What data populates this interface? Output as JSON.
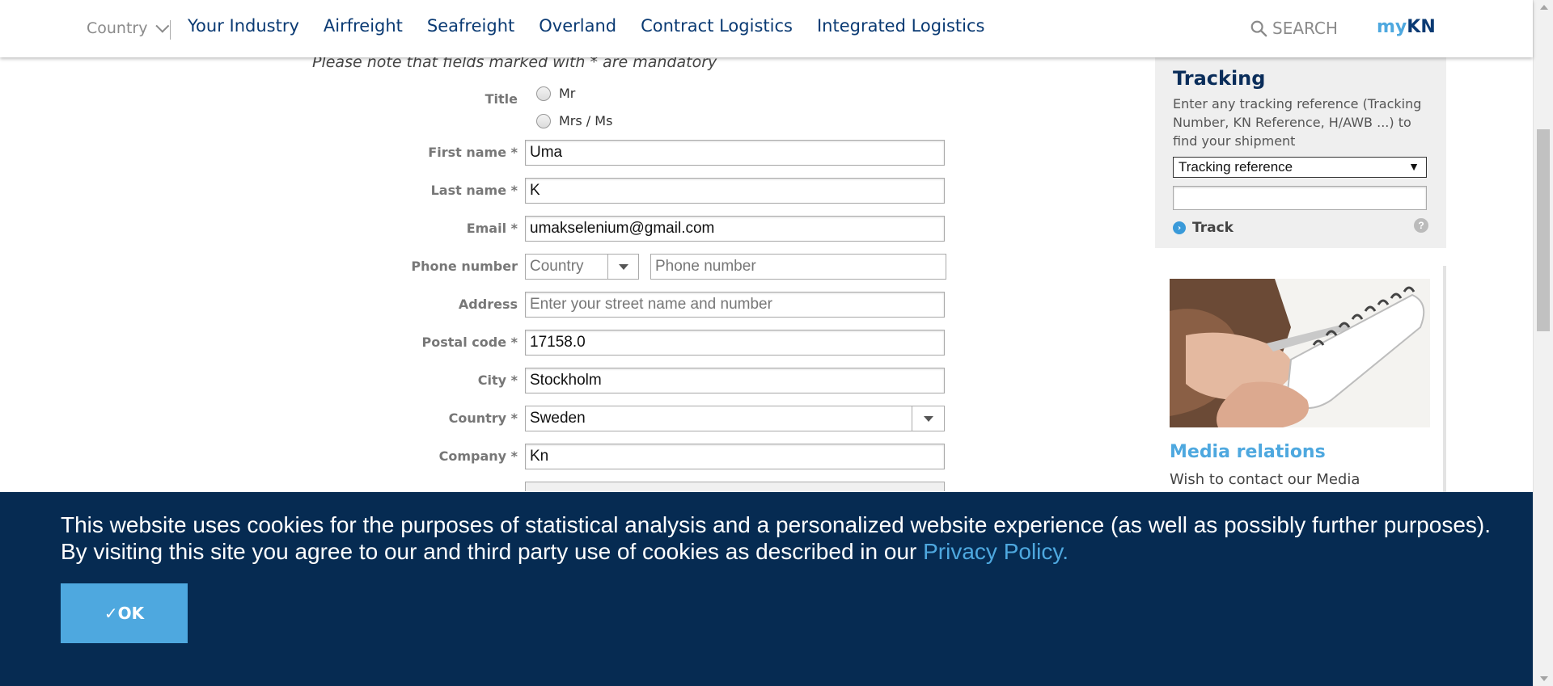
{
  "nav": {
    "country_label": "Country",
    "links": [
      "Your Industry",
      "Airfreight",
      "Seafreight",
      "Overland",
      "Contract Logistics",
      "Integrated Logistics"
    ],
    "search_label": "SEARCH",
    "mykn_my": "my",
    "mykn_kn": "KN"
  },
  "form": {
    "mandatory_note": "Please note that fields marked with * are mandatory",
    "title_label": "Title",
    "title_options": [
      "Mr",
      "Mrs / Ms"
    ],
    "first_name_label": "First name *",
    "first_name_value": "Uma",
    "last_name_label": "Last name *",
    "last_name_value": "K",
    "email_label": "Email *",
    "email_value": "umakselenium@gmail.com",
    "phone_label": "Phone number",
    "phone_country_placeholder": "Country",
    "phone_number_placeholder": "Phone number",
    "address_label": "Address",
    "address_placeholder": "Enter your street name and number",
    "postal_label": "Postal code *",
    "postal_value": "17158.0",
    "city_label": "City *",
    "city_value": "Stockholm",
    "country_label": "Country *",
    "country_value": "Sweden",
    "company_label": "Company *",
    "company_value": "Kn"
  },
  "tracking": {
    "title": "Tracking",
    "description": "Enter any tracking reference (Tracking Number, KN Reference, H/AWB ...) to find your shipment",
    "select_value": "Tracking reference",
    "button_label": "Track",
    "help": "?"
  },
  "media": {
    "title": "Media relations",
    "text": "Wish to contact our Media"
  },
  "cookie": {
    "text": "This website uses cookies for the purposes of statistical analysis and a personalized website experience (as well as possibly further purposes). By visiting this site you agree to our and third party use of cookies as described in our ",
    "link": "Privacy Policy.",
    "ok_label": "✓OK"
  },
  "colors": {
    "navy": "#0a3a73",
    "accent_blue": "#4ea8df",
    "banner_bg": "#062b52"
  }
}
